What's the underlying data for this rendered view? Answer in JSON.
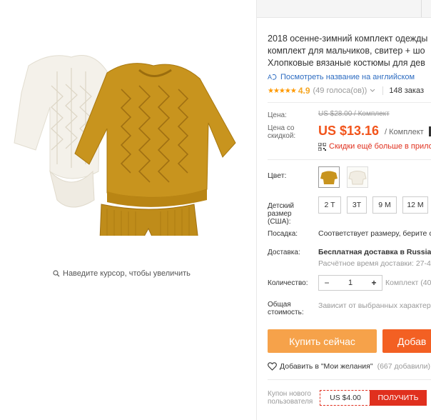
{
  "gallery": {
    "zoom_hint": "Наведите курсор, чтобы увеличить"
  },
  "product": {
    "title_lines": [
      "2018 осенне-зимний комплект одежды",
      "комплект для мальчиков, свитер + шо",
      "Хлопковые вязаные костюмы для дев"
    ],
    "translate_link": "Посмотреть название на английском",
    "rating": {
      "stars": "★★★★★",
      "value": "4.9",
      "votes": "(49 голоса(ов))",
      "orders": "148 заказ"
    }
  },
  "price": {
    "label": "Цена:",
    "old": "US $28.00 / Комплект",
    "discount_label": "Цена со скидкой:",
    "current": "US $13.16",
    "unit": "/ Комплект",
    "promo": "Скидки ещё больше в прилож"
  },
  "options": {
    "color_label": "Цвет:",
    "size_label": "Детский размер (США):",
    "sizes": [
      "2 T",
      "3T",
      "9 M",
      "12 M"
    ],
    "fit_label": "Посадка:",
    "fit_value": "Соответствует размеру, берите с",
    "delivery_label": "Доставка:",
    "delivery_value": "Бесплатная доставка в Russian",
    "delivery_time": "Расчётное время доставки: 27-4",
    "quantity_label": "Количество:",
    "quantity": "1",
    "quantity_note": "Комплект (40",
    "total_label": "Общая стоимость:",
    "total_value": "Зависит от выбранных характер"
  },
  "actions": {
    "buy_now": "Купить сейчас",
    "add_to_cart": "Добав",
    "wishlist": "Добавить в \"Мои желания\"",
    "wishlist_count": "(667 добавили)"
  },
  "coupon": {
    "label": "Купон нового пользователя",
    "value": "US $4.00",
    "button": "ПОЛУЧИТЬ"
  },
  "colors": {
    "accent": "#f2541b",
    "buy": "#f6a24a",
    "cart": "#f36023",
    "mustard": "#c8941e",
    "link": "#2d6cc1"
  }
}
